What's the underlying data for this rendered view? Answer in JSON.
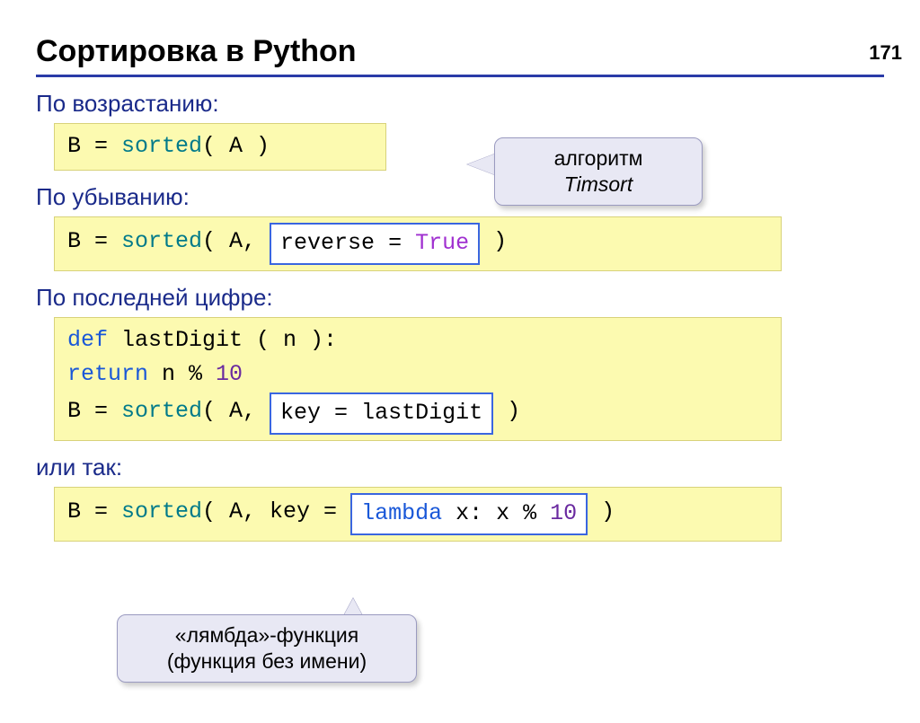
{
  "page_number": "171",
  "title": "Сортировка в Python",
  "sections": {
    "asc_label": "По возрастанию:",
    "desc_label": "По убыванию:",
    "lastdigit_label": "По последней цифре:",
    "or_label": "или так:"
  },
  "code": {
    "asc": {
      "pre": "B = ",
      "fn": "sorted",
      "args_open": "( A )",
      "args_close": ""
    },
    "desc": {
      "pre": "B = ",
      "fn": "sorted",
      "args_open": "( A, ",
      "inset_reverse": "reverse = ",
      "inset_true": "True",
      "args_close": "  )"
    },
    "lastdigit": {
      "l1_def": "def",
      "l1_rest": " lastDigit ( n ):",
      "l2_return": "  return",
      "l2_rest": " n % ",
      "l2_num": "10",
      "l3_pre": "B = ",
      "l3_fn": "sorted",
      "l3_open": "( A, ",
      "l3_inset": "key = lastDigit",
      "l3_close": "  )"
    },
    "lambda": {
      "pre": "B = ",
      "fn": "sorted",
      "open": "( A, key = ",
      "inset_kw": "lambda",
      "inset_mid": " x: x % ",
      "inset_num": "10",
      "close": "  )"
    }
  },
  "callouts": {
    "timsort_l1": "алгоритм",
    "timsort_l2": "Timsort",
    "lambda_l1": "«лямбда»-функция",
    "lambda_l2": "(функция без имени)"
  }
}
